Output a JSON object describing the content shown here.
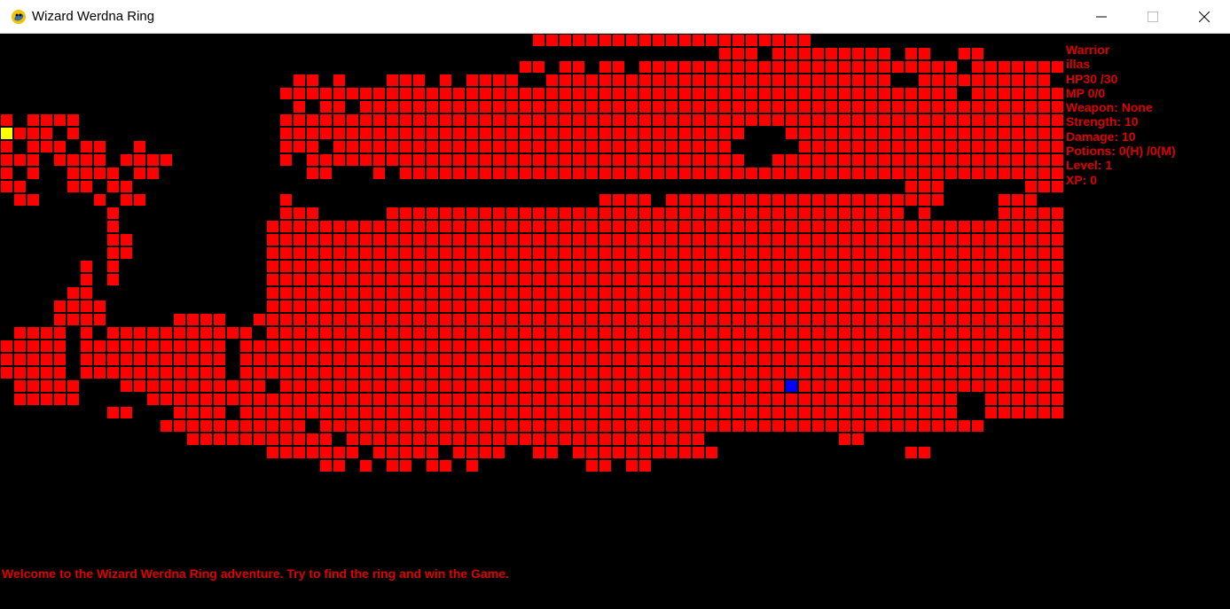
{
  "window": {
    "title": "Wizard Werdna Ring",
    "controls": [
      "minimize-icon",
      "maximize-icon",
      "close-icon"
    ]
  },
  "colors": {
    "tile": "#ff0000",
    "tile_border": "#000000",
    "player": "#ffff00",
    "ring": "#0000ff",
    "text": "#e00000"
  },
  "stats": {
    "class_name": "Warrior",
    "player_name": "illas",
    "hp": "HP30 /30",
    "mp": "MP 0/0",
    "weapon": "Weapon: None",
    "strength": "Strength: 10",
    "damage": "Damage: 10",
    "potions": "Potions: 0(H) /0(M)",
    "level": "Level: 1",
    "xp": "XP: 0"
  },
  "message": "Welcome to the Wizard Werdna Ring adventure. Try to find the ring and win the Game.",
  "map": {
    "tile_size": 15,
    "rows": [
      "........................................#####################..................................",
      "......................................................###.#########.##..##.....................",
      ".......................................##.##.##.########################.####################...",
      "......................##.#...###.#.####..##########################..##########.##.####.......",
      ".....................###################################################.#########..##...........",
      "......................#.##.#######################################################.###...........",
      "#.####...............##############################################################.###..........",
      "####.#...............###################################...########################.###..........",
      "#.###.##..#..........###.##############################.....###################################.",
      "###.####.####........#.#################################..#######################################",
      "#.#..####.##...........##...#.######################################################..#...........",
      "##...##.##..........................................................###......#####....#.......",
      ".##....#.##..........#.......................####.#####################....###...................",
      "........#............###.....#######################################.#.....######.................",
      "........#...........########################################################################....",
      "........##..........########################################################################....",
      "........##..........########################################################################....",
      "......#.#...........########################################################################....",
      "......#.#...........########################################################################....",
      ".....##.............########################################################################....",
      "....####............########################################################################....",
      "....####.....####..#########################################################################....",
      ".####.#.###########.#######################################################################.####",
      "#####.###########.##########################################################################...",
      "#####.###########.##########################################################################...",
      "#####.###########.##########################################################################...",
      ".#####...###########.#######################################################################...",
      ".#####.....#############################################################..########.###..........",
      "........##...####.######################################################..#########.###.........",
      "............###########.##################################################...........##........",
      "..............###########.###########################..........##.....................#.........",
      "....................#######.#####.####..##.###########..............##..............#########....",
      "........................##.#.##.##.#........##.##.........................................#####...",
      "..........................................................................................######",
      "..........................................................................................######"
    ],
    "player": {
      "col": 0,
      "row": 7
    },
    "ring": {
      "col": 59,
      "row": 26
    }
  }
}
